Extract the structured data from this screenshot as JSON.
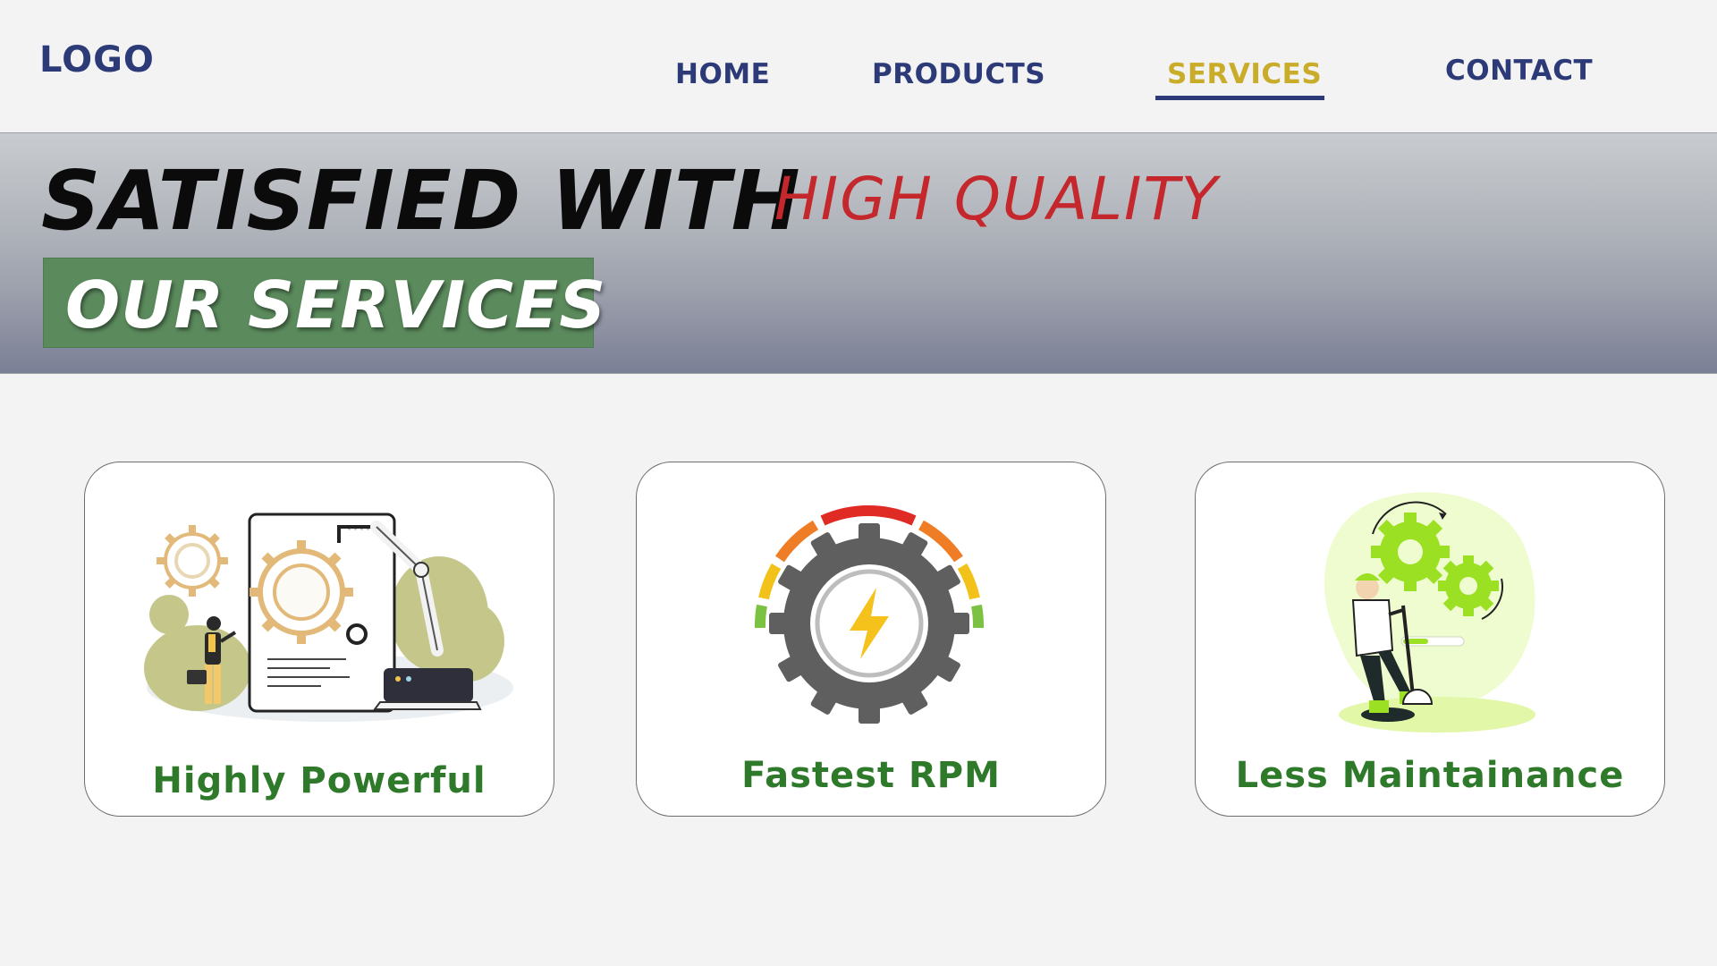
{
  "header": {
    "logo": "LOGO",
    "nav": [
      {
        "label": "HOME"
      },
      {
        "label": "PRODUCTS"
      },
      {
        "label": "SERVICES",
        "active": true
      },
      {
        "label": "CONTACT"
      }
    ]
  },
  "hero": {
    "title": "SATISFIED WITH",
    "subtitle": "HIGH QUALITY",
    "box_text": "OUR SERVICES"
  },
  "cards": [
    {
      "label": "Highly Powerful",
      "icon": "factory-robot-arm-gears-illustration"
    },
    {
      "label": "Fastest RPM",
      "icon": "gear-speedometer-lightning-icon"
    },
    {
      "label": "Less Maintainance",
      "icon": "worker-with-gears-illustration"
    }
  ],
  "colors": {
    "brand_navy": "#2c3a78",
    "active_nav": "#c9ac2a",
    "hero_accent_red": "#c4282c",
    "hero_box_green": "#5b8b5d",
    "card_label_green": "#2e7a2a"
  }
}
